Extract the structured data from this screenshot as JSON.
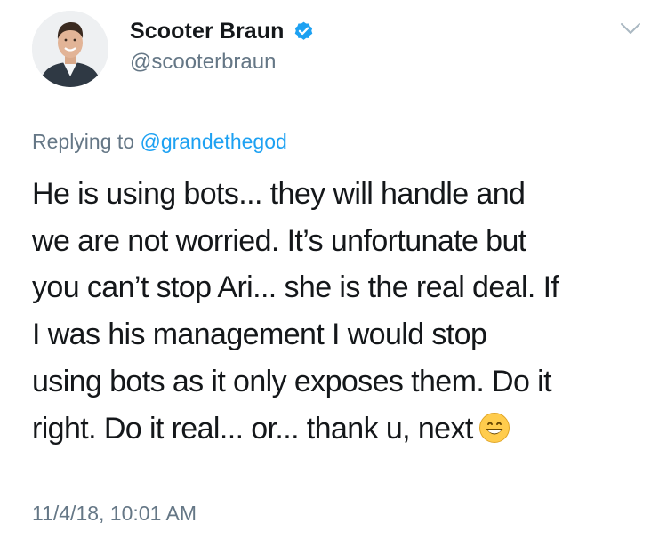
{
  "author": {
    "display_name": "Scooter Braun",
    "handle": "@scooterbraun",
    "verified": true,
    "avatar_icon": "profile-photo"
  },
  "reply": {
    "prefix": "Replying to",
    "mention": "@grandethegod"
  },
  "tweet": {
    "lines": [
      "He is using bots... they will handle and",
      "we are not worried. It’s unfortunate but",
      "you can’t stop Ari... she is the real deal. If",
      "I was his management I would stop",
      "using bots as it only exposes them. Do it",
      "right. Do it real... or... thank u, next"
    ],
    "emoji": "grinning-face-with-smiling-eyes"
  },
  "timestamp": "11/4/18, 10:01 AM",
  "colors": {
    "text": "#14171a",
    "secondary": "#657786",
    "link": "#1da1f2",
    "verified_badge": "#1da1f2"
  },
  "icons": {
    "menu": "chevron-down-icon",
    "badge": "verified-badge-icon"
  }
}
